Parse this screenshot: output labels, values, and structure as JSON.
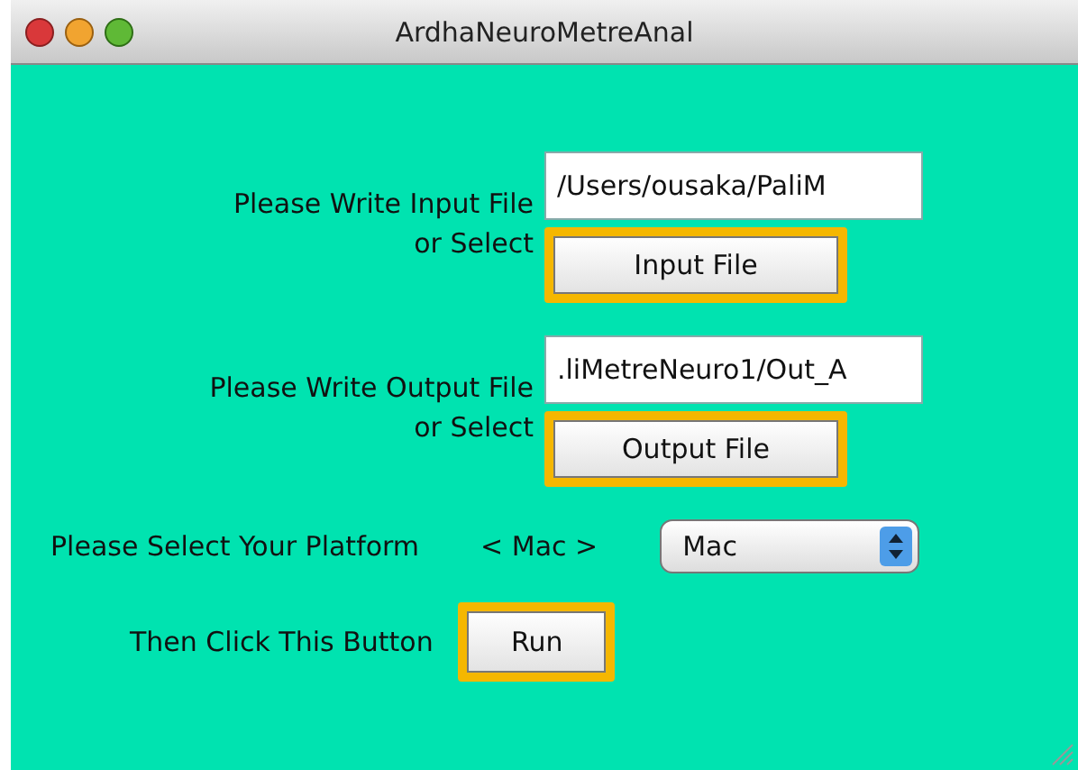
{
  "window": {
    "title": "ArdhaNeuroMetreAnal"
  },
  "input": {
    "label": "Please Write Input File",
    "value": "/Users/ousaka/PaliM",
    "select_label": "or Select",
    "button": "Input File"
  },
  "output": {
    "label": "Please Write Output File",
    "value": ".liMetreNeuro1/Out_A",
    "select_label": "or Select",
    "button": "Output File"
  },
  "platform": {
    "label": "Please Select Your Platform",
    "current": "< Mac >",
    "dropdown": "Mac"
  },
  "run": {
    "label": "Then Click This Button",
    "button": "Run"
  }
}
